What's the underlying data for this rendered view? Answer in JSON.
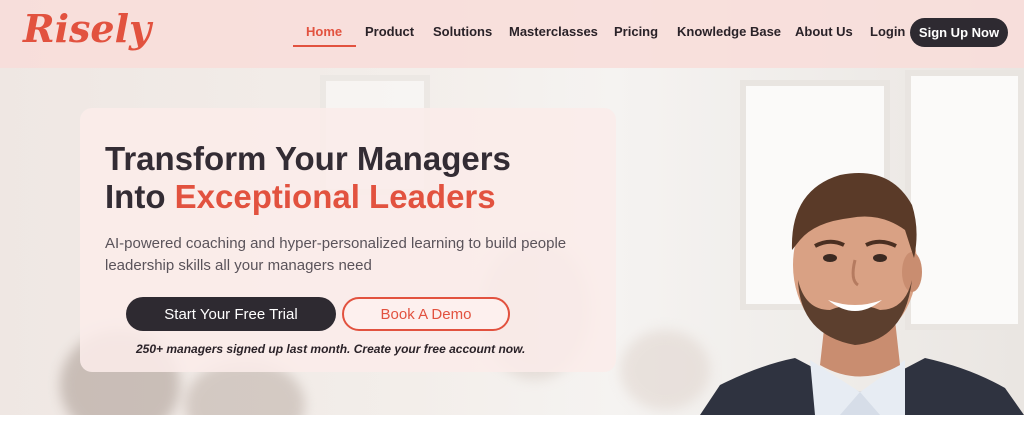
{
  "brand": {
    "logo_text": "Risely",
    "accent_color": "#e2523f",
    "dark_color": "#2e2a31"
  },
  "nav": {
    "items": [
      {
        "label": "Home",
        "active": true
      },
      {
        "label": "Product"
      },
      {
        "label": "Solutions"
      },
      {
        "label": "Masterclasses"
      },
      {
        "label": "Pricing"
      },
      {
        "label": "Knowledge Base"
      },
      {
        "label": "About Us"
      },
      {
        "label": "Login"
      }
    ],
    "signup_label": "Sign Up Now"
  },
  "hero": {
    "headline_line1": "Transform Your Managers",
    "headline_line2_prefix": "Into ",
    "headline_line2_accent": "Exceptional Leaders",
    "subtext": "AI-powered coaching and hyper-personalized learning to build people leadership skills all your managers need",
    "primary_cta": "Start Your Free Trial",
    "secondary_cta": "Book A Demo",
    "note": "250+ managers signed up last month. Create your free account now."
  },
  "icons": {
    "hero_image": "smiling-man-portrait"
  }
}
